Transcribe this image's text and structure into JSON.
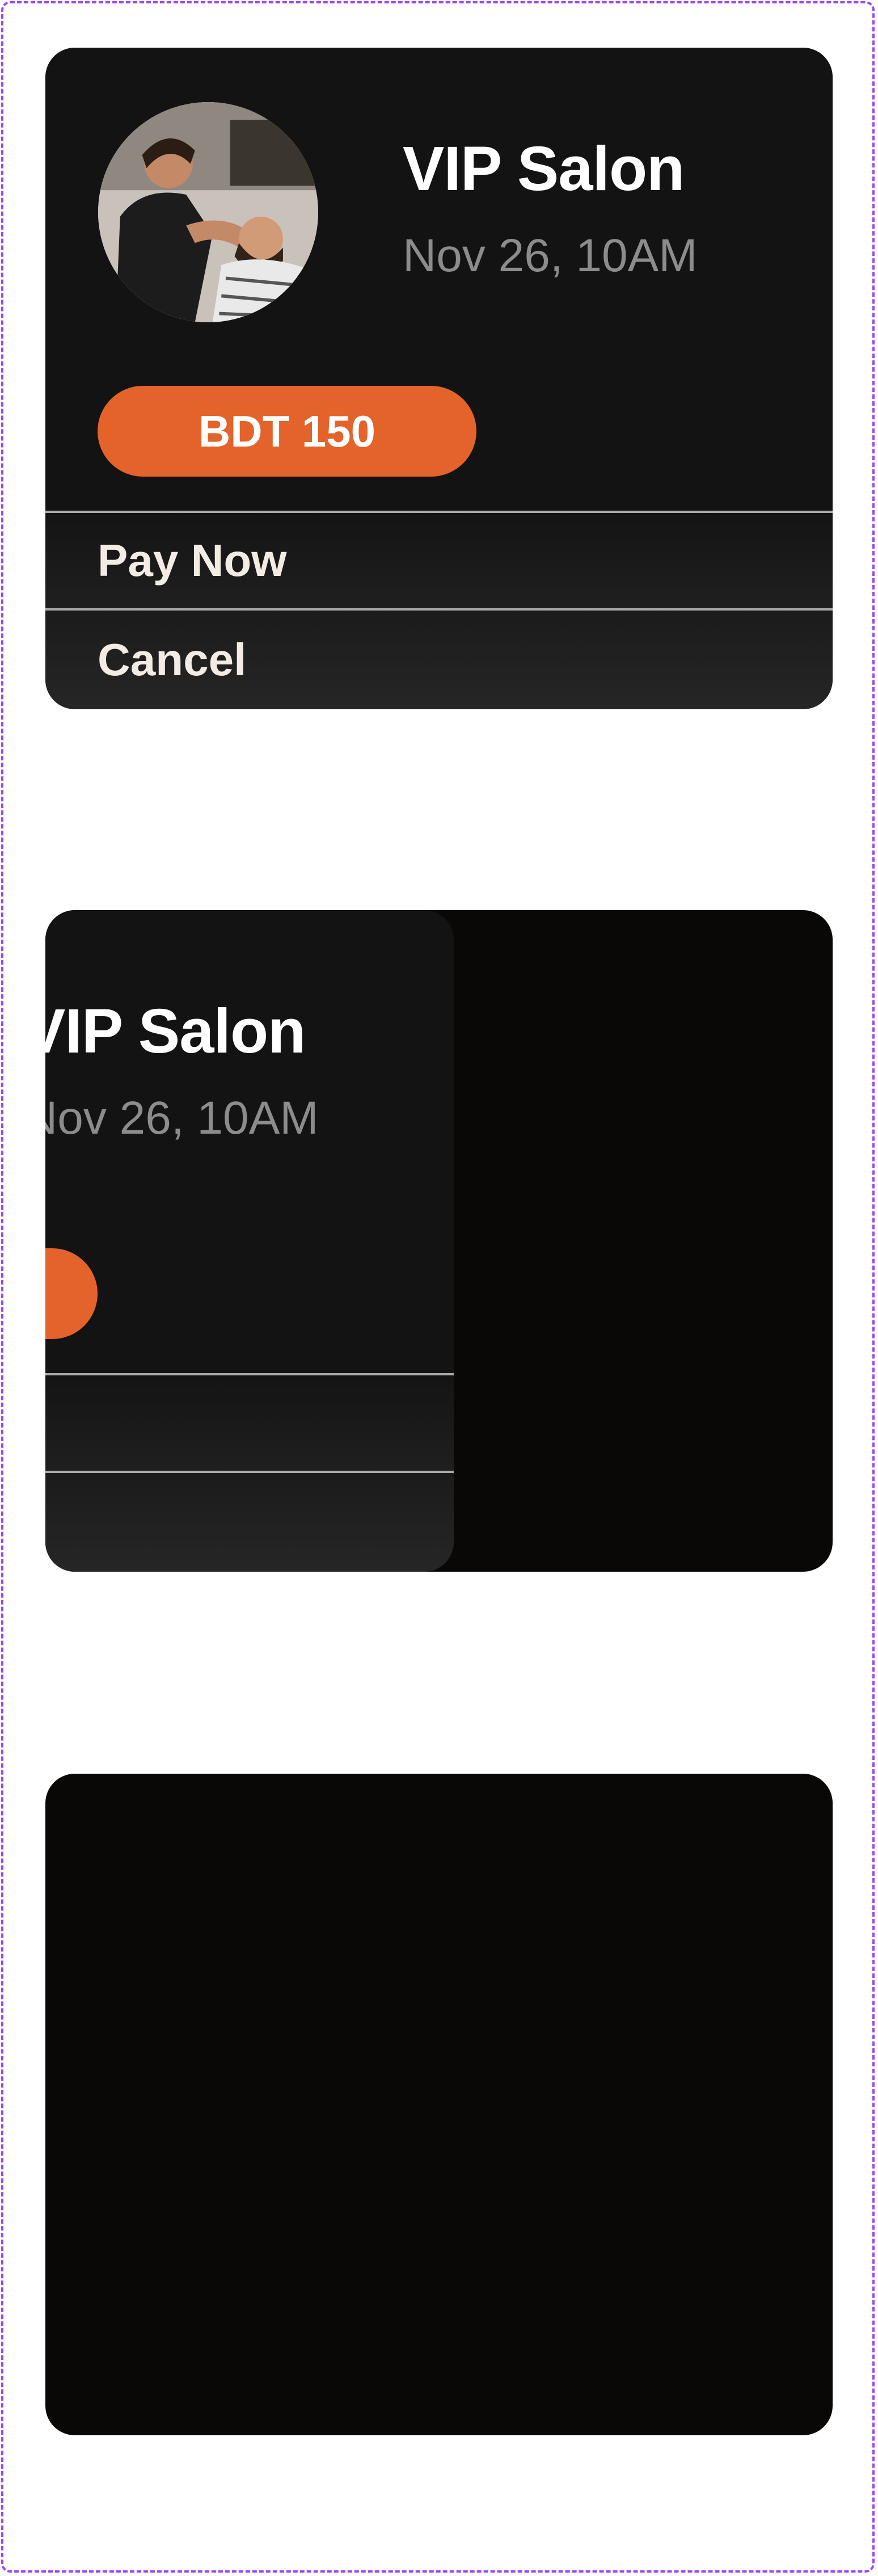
{
  "booking": {
    "venue": "VIP Salon",
    "datetime": "Nov 26, 10AM",
    "price": "BDT 150",
    "actions": {
      "pay": "Pay Now",
      "cancel": "Cancel"
    },
    "avatar_icon": "barber-photo"
  },
  "colors": {
    "accent": "#e3632a",
    "card": "#131313",
    "background": "#090806",
    "muted_text": "#8c8c8c",
    "divider": "#a9a9a9",
    "frame": "#9747ff"
  }
}
